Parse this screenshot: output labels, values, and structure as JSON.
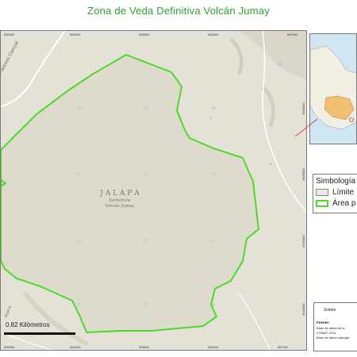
{
  "title": "Zona de Veda Definitiva Volcán Jumay",
  "map": {
    "area_label_line1": "J A L A P A",
    "area_label_line2": "Definitiva",
    "area_label_line3": "Volcán Jumay",
    "road_label": "Ruta A Pastores Carrizal",
    "road_label_2": "Ruta a",
    "top_coords": [
      "550000",
      "554000",
      "558000",
      "562000",
      "567000"
    ],
    "bottom_coords": [
      "550000",
      "554000",
      "558000",
      "562000",
      "567000"
    ],
    "right_coords": [
      "1630000",
      "1628000",
      "1626000",
      "1624000",
      "1622000"
    ],
    "boundary_color": "#4cd92c",
    "terrain_color": "#e4e1d6"
  },
  "scale": {
    "label": "0.82 Kilómetros"
  },
  "legend": {
    "title": "Simbología",
    "items": [
      {
        "label": "Límite",
        "fill": "#ecebe8",
        "stroke": "#888888"
      },
      {
        "label": "Área p",
        "fill": "#ffffff",
        "stroke": "#4cd92c"
      }
    ]
  },
  "info": {
    "heading": "Sistem",
    "source_label": "Fuente:",
    "source_line1": "Base de datos de la",
    "source_line2": "CONAP 2016",
    "source_line3": "Base de datos cartogra"
  }
}
